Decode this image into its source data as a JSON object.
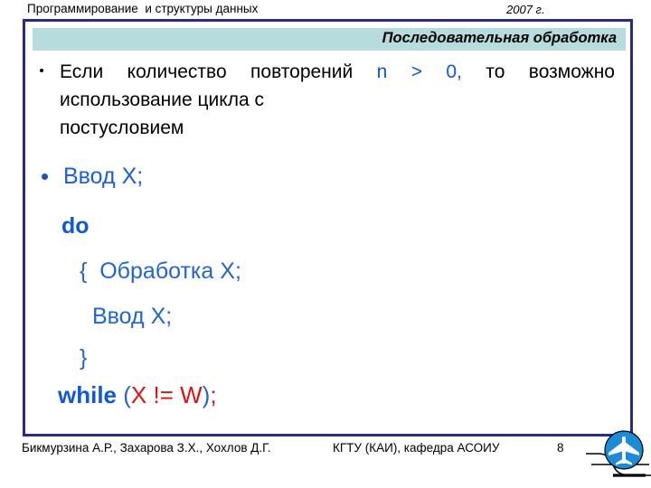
{
  "header": {
    "course": "Программирование  и структуры данных",
    "year": "2007 г."
  },
  "title": {
    "text": "Последовательная обработка"
  },
  "content": {
    "bullet1": {
      "line1_before": "Если  количество  повторений ",
      "line1_code": "n   >  0,",
      "line1_after": "  то",
      "line2": "возможно      использование      цикла      с",
      "line3": "постусловием"
    },
    "bullet2": {
      "text": "Ввод X;"
    },
    "code": {
      "do": "do",
      "open_brace": "{  Обработка X;",
      "input": "Ввод X;",
      "close_brace": "}",
      "while_kw": "while",
      "paren_open": " (",
      "condition": "X != W",
      "paren_close": ")",
      "semicolon": ";"
    }
  },
  "footer": {
    "authors": "Бикмурзина А.Р., Захарова З.Х., Хохлов Д.Г.",
    "department": "КГТУ  (КАИ),  кафедра АСОИУ",
    "page": "8"
  },
  "colors": {
    "frame_border": "#2A2A8C",
    "title_band": "#B6DCDE",
    "code_blue": "#1B5EDC",
    "keyword_blue": "#1158D8",
    "condition_red": "#DD1111",
    "logo_blue": "#1E8BD6"
  }
}
